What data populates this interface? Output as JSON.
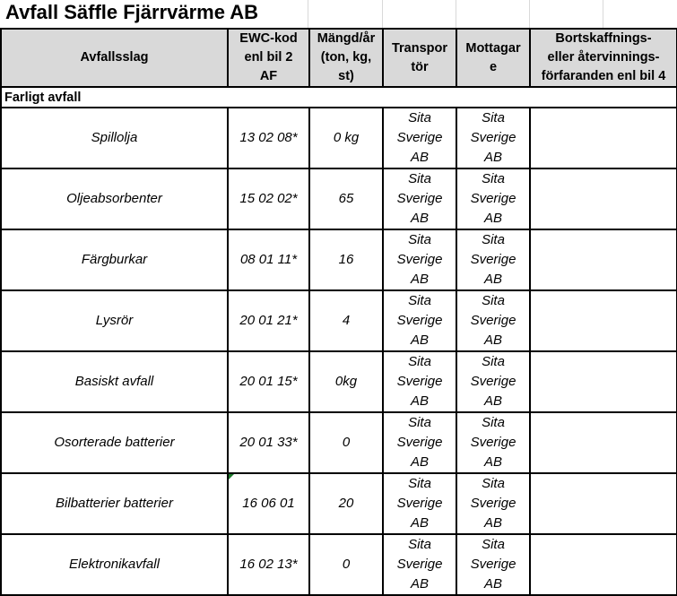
{
  "title": "Avfall Säffle Fjärrvärme AB",
  "headers": {
    "avfallsslag": "Avfallsslag",
    "ewc_1": "EWC-kod",
    "ewc_2": "enl bil 2",
    "ewc_3": "AF",
    "mangd_1": "Mängd/år",
    "mangd_2": "(ton, kg,",
    "mangd_3": "st)",
    "transport_1": "Transpor",
    "transport_2": "tör",
    "mottagare_1": "Mottagar",
    "mottagare_2": "e",
    "bort_1": "Bortskaffnings-",
    "bort_2": "eller återvinnings-",
    "bort_3": "förfaranden enl bil 4"
  },
  "section": "Farligt avfall",
  "rows": [
    {
      "avfallsslag": "Spillolja",
      "ewc": "13 02 08*",
      "mangd": "0 kg",
      "transportor": [
        "Sita",
        "Sverige",
        "AB"
      ],
      "mottagare": [
        "Sita",
        "Sverige",
        "AB"
      ],
      "forfarande": ""
    },
    {
      "avfallsslag": "Oljeabsorbenter",
      "ewc": "15 02 02*",
      "mangd": "65",
      "transportor": [
        "Sita",
        "Sverige",
        "AB"
      ],
      "mottagare": [
        "Sita",
        "Sverige",
        "AB"
      ],
      "forfarande": ""
    },
    {
      "avfallsslag": "Färgburkar",
      "ewc": "08 01 11*",
      "mangd": "16",
      "transportor": [
        "Sita",
        "Sverige",
        "AB"
      ],
      "mottagare": [
        "Sita",
        "Sverige",
        "AB"
      ],
      "forfarande": ""
    },
    {
      "avfallsslag": "Lysrör",
      "ewc": "20 01 21*",
      "mangd": "4",
      "transportor": [
        "Sita",
        "Sverige",
        "AB"
      ],
      "mottagare": [
        "Sita",
        "Sverige",
        "AB"
      ],
      "forfarande": ""
    },
    {
      "avfallsslag": "Basiskt avfall",
      "ewc": "20 01 15*",
      "mangd": "0kg",
      "transportor": [
        "Sita",
        "Sverige",
        "AB"
      ],
      "mottagare": [
        "Sita",
        "Sverige",
        "AB"
      ],
      "forfarande": ""
    },
    {
      "avfallsslag": "Osorterade batterier",
      "ewc": "20 01 33*",
      "mangd": "0",
      "transportor": [
        "Sita",
        "Sverige",
        "AB"
      ],
      "mottagare": [
        "Sita",
        "Sverige",
        "AB"
      ],
      "forfarande": ""
    },
    {
      "avfallsslag": "Bilbatterier batterier",
      "ewc": "16 06 01",
      "mangd": "20",
      "transportor": [
        "Sita",
        "Sverige",
        "AB"
      ],
      "mottagare": [
        "Sita",
        "Sverige",
        "AB"
      ],
      "forfarande": ""
    },
    {
      "avfallsslag": "Elektronikavfall",
      "ewc": "16 02 13*",
      "mangd": "0",
      "transportor": [
        "Sita",
        "Sverige",
        "AB"
      ],
      "mottagare": [
        "Sita",
        "Sverige",
        "AB"
      ],
      "forfarande": ""
    }
  ]
}
